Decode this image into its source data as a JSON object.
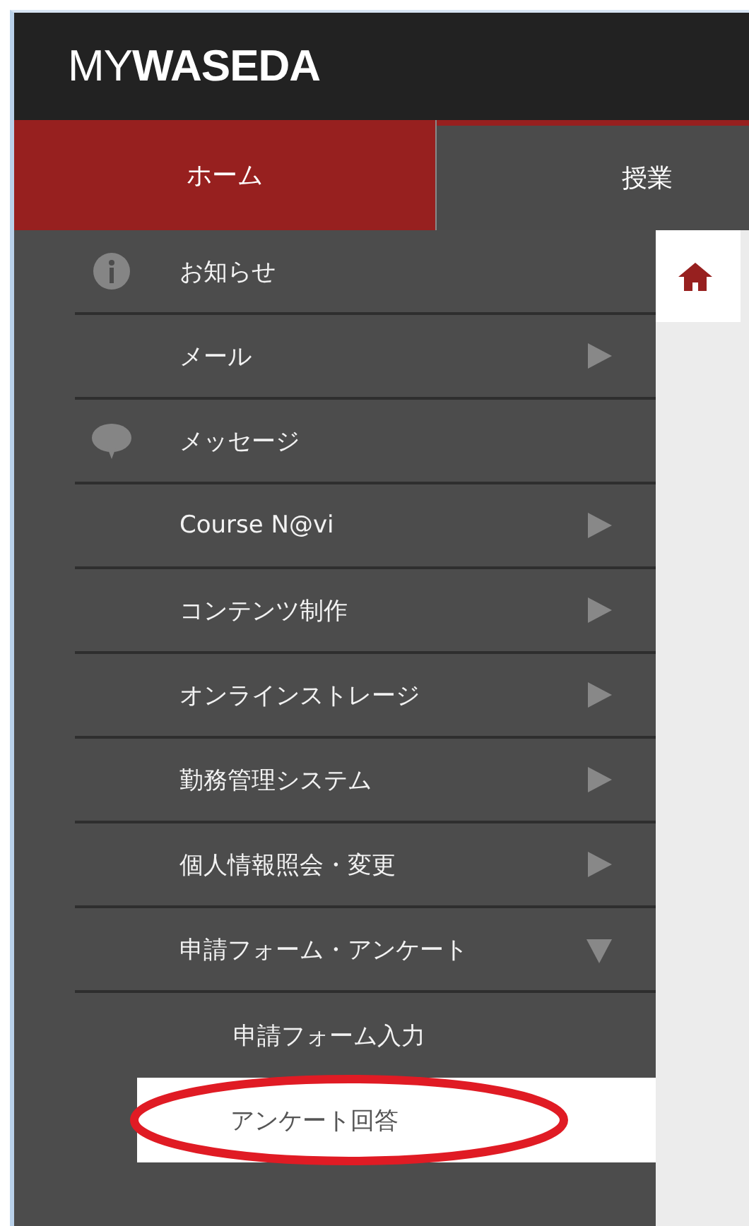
{
  "header": {
    "logo_light": "MY",
    "logo_bold": "WASEDA"
  },
  "tabs": [
    {
      "label": "ホーム",
      "selected": true
    },
    {
      "label": "授業",
      "selected": false
    }
  ],
  "menu": [
    {
      "label": "お知らせ",
      "kind": "notice"
    },
    {
      "label": "メール",
      "kind": "folder",
      "expanded": false
    },
    {
      "label": "メッセージ",
      "kind": "message"
    },
    {
      "label": "Course N@vi",
      "kind": "folder",
      "expanded": false
    },
    {
      "label": "コンテンツ制作",
      "kind": "folder",
      "expanded": false
    },
    {
      "label": "オンラインストレージ",
      "kind": "folder",
      "expanded": false
    },
    {
      "label": "勤務管理システム",
      "kind": "folder",
      "expanded": false
    },
    {
      "label": "個人情報照会・変更",
      "kind": "folder",
      "expanded": false
    },
    {
      "label": "申請フォーム・アンケート",
      "kind": "folder",
      "expanded": true,
      "children": [
        {
          "label": "申請フォーム入力",
          "selected": false
        },
        {
          "label": "アンケート回答",
          "selected": true
        }
      ]
    }
  ]
}
